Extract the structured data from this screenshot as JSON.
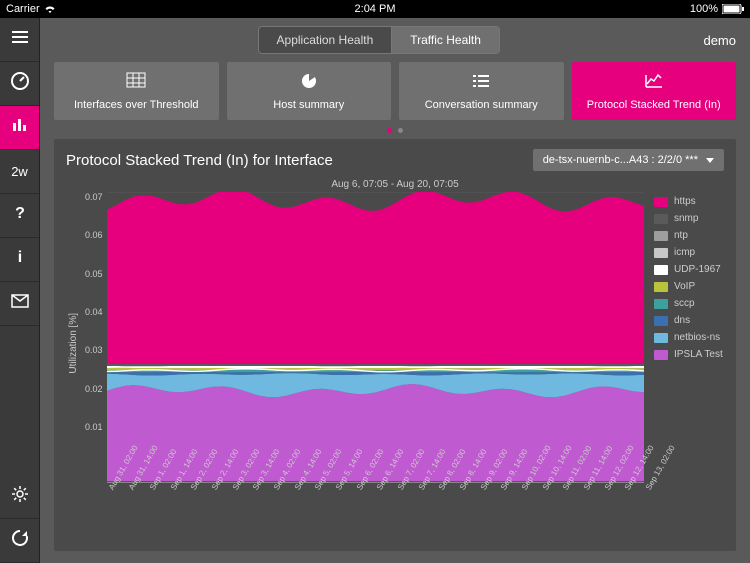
{
  "status": {
    "carrier": "Carrier",
    "time": "2:04 PM",
    "battery": "100%"
  },
  "user": "demo",
  "sidebar": {
    "items": [
      {
        "name": "menu",
        "icon": "menu"
      },
      {
        "name": "dashboard",
        "icon": "gauge"
      },
      {
        "name": "stats",
        "icon": "bars",
        "active": true
      },
      {
        "name": "timerange",
        "text": "2w"
      },
      {
        "name": "help",
        "icon": "help"
      },
      {
        "name": "info",
        "icon": "info"
      },
      {
        "name": "mail",
        "icon": "mail"
      }
    ],
    "bottom": [
      {
        "name": "settings",
        "icon": "gear"
      },
      {
        "name": "refresh",
        "icon": "refresh"
      }
    ]
  },
  "segmented": {
    "options": [
      "Application Health",
      "Traffic Health"
    ],
    "active": 1
  },
  "tiles": [
    {
      "label": "Interfaces over Threshold",
      "icon": "grid"
    },
    {
      "label": "Host summary",
      "icon": "pie"
    },
    {
      "label": "Conversation summary",
      "icon": "list"
    },
    {
      "label": "Protocol Stacked Trend (In)",
      "icon": "line",
      "active": true
    }
  ],
  "dots": {
    "count": 2,
    "active": 0
  },
  "panel": {
    "title": "Protocol Stacked Trend (In) for Interface",
    "interface": "de-tsx-nuernb-c...A43 : 2/2/0 ***"
  },
  "chart_data": {
    "type": "area",
    "title": "Aug 6, 07:05 - Aug 20, 07:05",
    "ylabel": "Utilization [%]",
    "ylim": [
      0,
      0.07
    ],
    "yticks": [
      0.07,
      0.06,
      0.05,
      0.04,
      0.03,
      0.02,
      0.01
    ],
    "xticks": [
      "Aug 31, 02:00",
      "Aug 31, 14:00",
      "Sep 1, 02:00",
      "Sep 1, 14:00",
      "Sep 2, 02:00",
      "Sep 2, 14:00",
      "Sep 3, 02:00",
      "Sep 3, 14:00",
      "Sep 4, 02:00",
      "Sep 4, 14:00",
      "Sep 5, 02:00",
      "Sep 5, 14:00",
      "Sep 6, 02:00",
      "Sep 6, 14:00",
      "Sep 7, 02:00",
      "Sep 7, 14:00",
      "Sep 8, 02:00",
      "Sep 8, 14:00",
      "Sep 9, 02:00",
      "Sep 9, 14:00",
      "Sep 10, 02:00",
      "Sep 10, 14:00",
      "Sep 11, 02:00",
      "Sep 11, 14:00",
      "Sep 12, 02:00",
      "Sep 12, 14:00",
      "Sep 13, 02:00"
    ],
    "series": [
      {
        "name": "https",
        "color": "#e6007e"
      },
      {
        "name": "snmp",
        "color": "#5a5a5a"
      },
      {
        "name": "ntp",
        "color": "#9e9e9e"
      },
      {
        "name": "icmp",
        "color": "#c8c8c8"
      },
      {
        "name": "UDP-1967",
        "color": "#ffffff"
      },
      {
        "name": "VoIP",
        "color": "#b8c43c"
      },
      {
        "name": "sccp",
        "color": "#3aa0a0"
      },
      {
        "name": "dns",
        "color": "#3a6fb0"
      },
      {
        "name": "netbios-ns",
        "color": "#6fb8e0"
      },
      {
        "name": "IPSLA Test",
        "color": "#c05ad0"
      }
    ],
    "stack_top_total": 0.068,
    "bands": [
      {
        "name": "IPSLA Test",
        "color": "#c05ad0",
        "from": 0.0,
        "to": 0.022
      },
      {
        "name": "netbios-ns",
        "color": "#6fb8e0",
        "from": 0.022,
        "to": 0.026
      },
      {
        "name": "dns",
        "color": "#3a6fb0",
        "from": 0.026,
        "to": 0.0265
      },
      {
        "name": "sccp",
        "color": "#3aa0a0",
        "from": 0.0265,
        "to": 0.027
      },
      {
        "name": "VoIP",
        "color": "#b8c43c",
        "from": 0.027,
        "to": 0.0275
      },
      {
        "name": "UDP-1967",
        "color": "#ffffff",
        "from": 0.0275,
        "to": 0.028
      },
      {
        "name": "snmp",
        "color": "#5a5a5a",
        "from": 0.028,
        "to": 0.0285
      },
      {
        "name": "https",
        "color": "#e6007e",
        "from": 0.0285,
        "to": 0.068
      }
    ]
  }
}
